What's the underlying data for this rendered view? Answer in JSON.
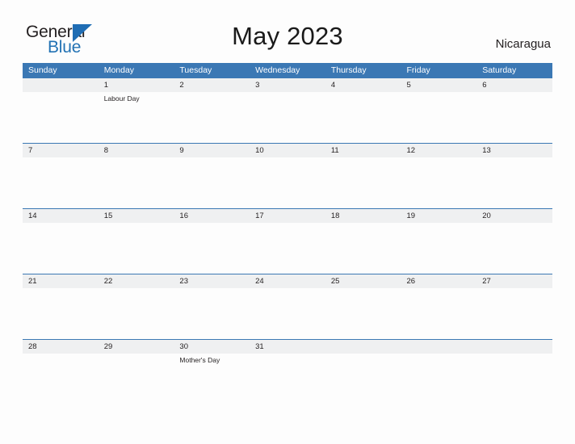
{
  "brand": {
    "name_top": "General",
    "name_bottom": "Blue",
    "triangle_icon": "blue-triangle-logo-mark",
    "color_dark": "#231f20",
    "color_blue": "#2272b4"
  },
  "header": {
    "title": "May 2023",
    "country": "Nicaragua"
  },
  "theme": {
    "header_blue": "#3b78b4",
    "date_band_gray": "#eff0f1",
    "page_background": "#fdfdfd",
    "text": "#231f20"
  },
  "calendar": {
    "month": "May",
    "year": "2023",
    "day_headers": [
      "Sunday",
      "Monday",
      "Tuesday",
      "Wednesday",
      "Thursday",
      "Friday",
      "Saturday"
    ],
    "weeks": [
      {
        "days": [
          {
            "date": "",
            "events": []
          },
          {
            "date": "1",
            "events": [
              "Labour Day"
            ]
          },
          {
            "date": "2",
            "events": []
          },
          {
            "date": "3",
            "events": []
          },
          {
            "date": "4",
            "events": []
          },
          {
            "date": "5",
            "events": []
          },
          {
            "date": "6",
            "events": []
          }
        ]
      },
      {
        "days": [
          {
            "date": "7",
            "events": []
          },
          {
            "date": "8",
            "events": []
          },
          {
            "date": "9",
            "events": []
          },
          {
            "date": "10",
            "events": []
          },
          {
            "date": "11",
            "events": []
          },
          {
            "date": "12",
            "events": []
          },
          {
            "date": "13",
            "events": []
          }
        ]
      },
      {
        "days": [
          {
            "date": "14",
            "events": []
          },
          {
            "date": "15",
            "events": []
          },
          {
            "date": "16",
            "events": []
          },
          {
            "date": "17",
            "events": []
          },
          {
            "date": "18",
            "events": []
          },
          {
            "date": "19",
            "events": []
          },
          {
            "date": "20",
            "events": []
          }
        ]
      },
      {
        "days": [
          {
            "date": "21",
            "events": []
          },
          {
            "date": "22",
            "events": []
          },
          {
            "date": "23",
            "events": []
          },
          {
            "date": "24",
            "events": []
          },
          {
            "date": "25",
            "events": []
          },
          {
            "date": "26",
            "events": []
          },
          {
            "date": "27",
            "events": []
          }
        ]
      },
      {
        "days": [
          {
            "date": "28",
            "events": []
          },
          {
            "date": "29",
            "events": []
          },
          {
            "date": "30",
            "events": [
              "Mother's Day"
            ]
          },
          {
            "date": "31",
            "events": []
          },
          {
            "date": "",
            "events": []
          },
          {
            "date": "",
            "events": []
          },
          {
            "date": "",
            "events": []
          }
        ]
      }
    ]
  }
}
